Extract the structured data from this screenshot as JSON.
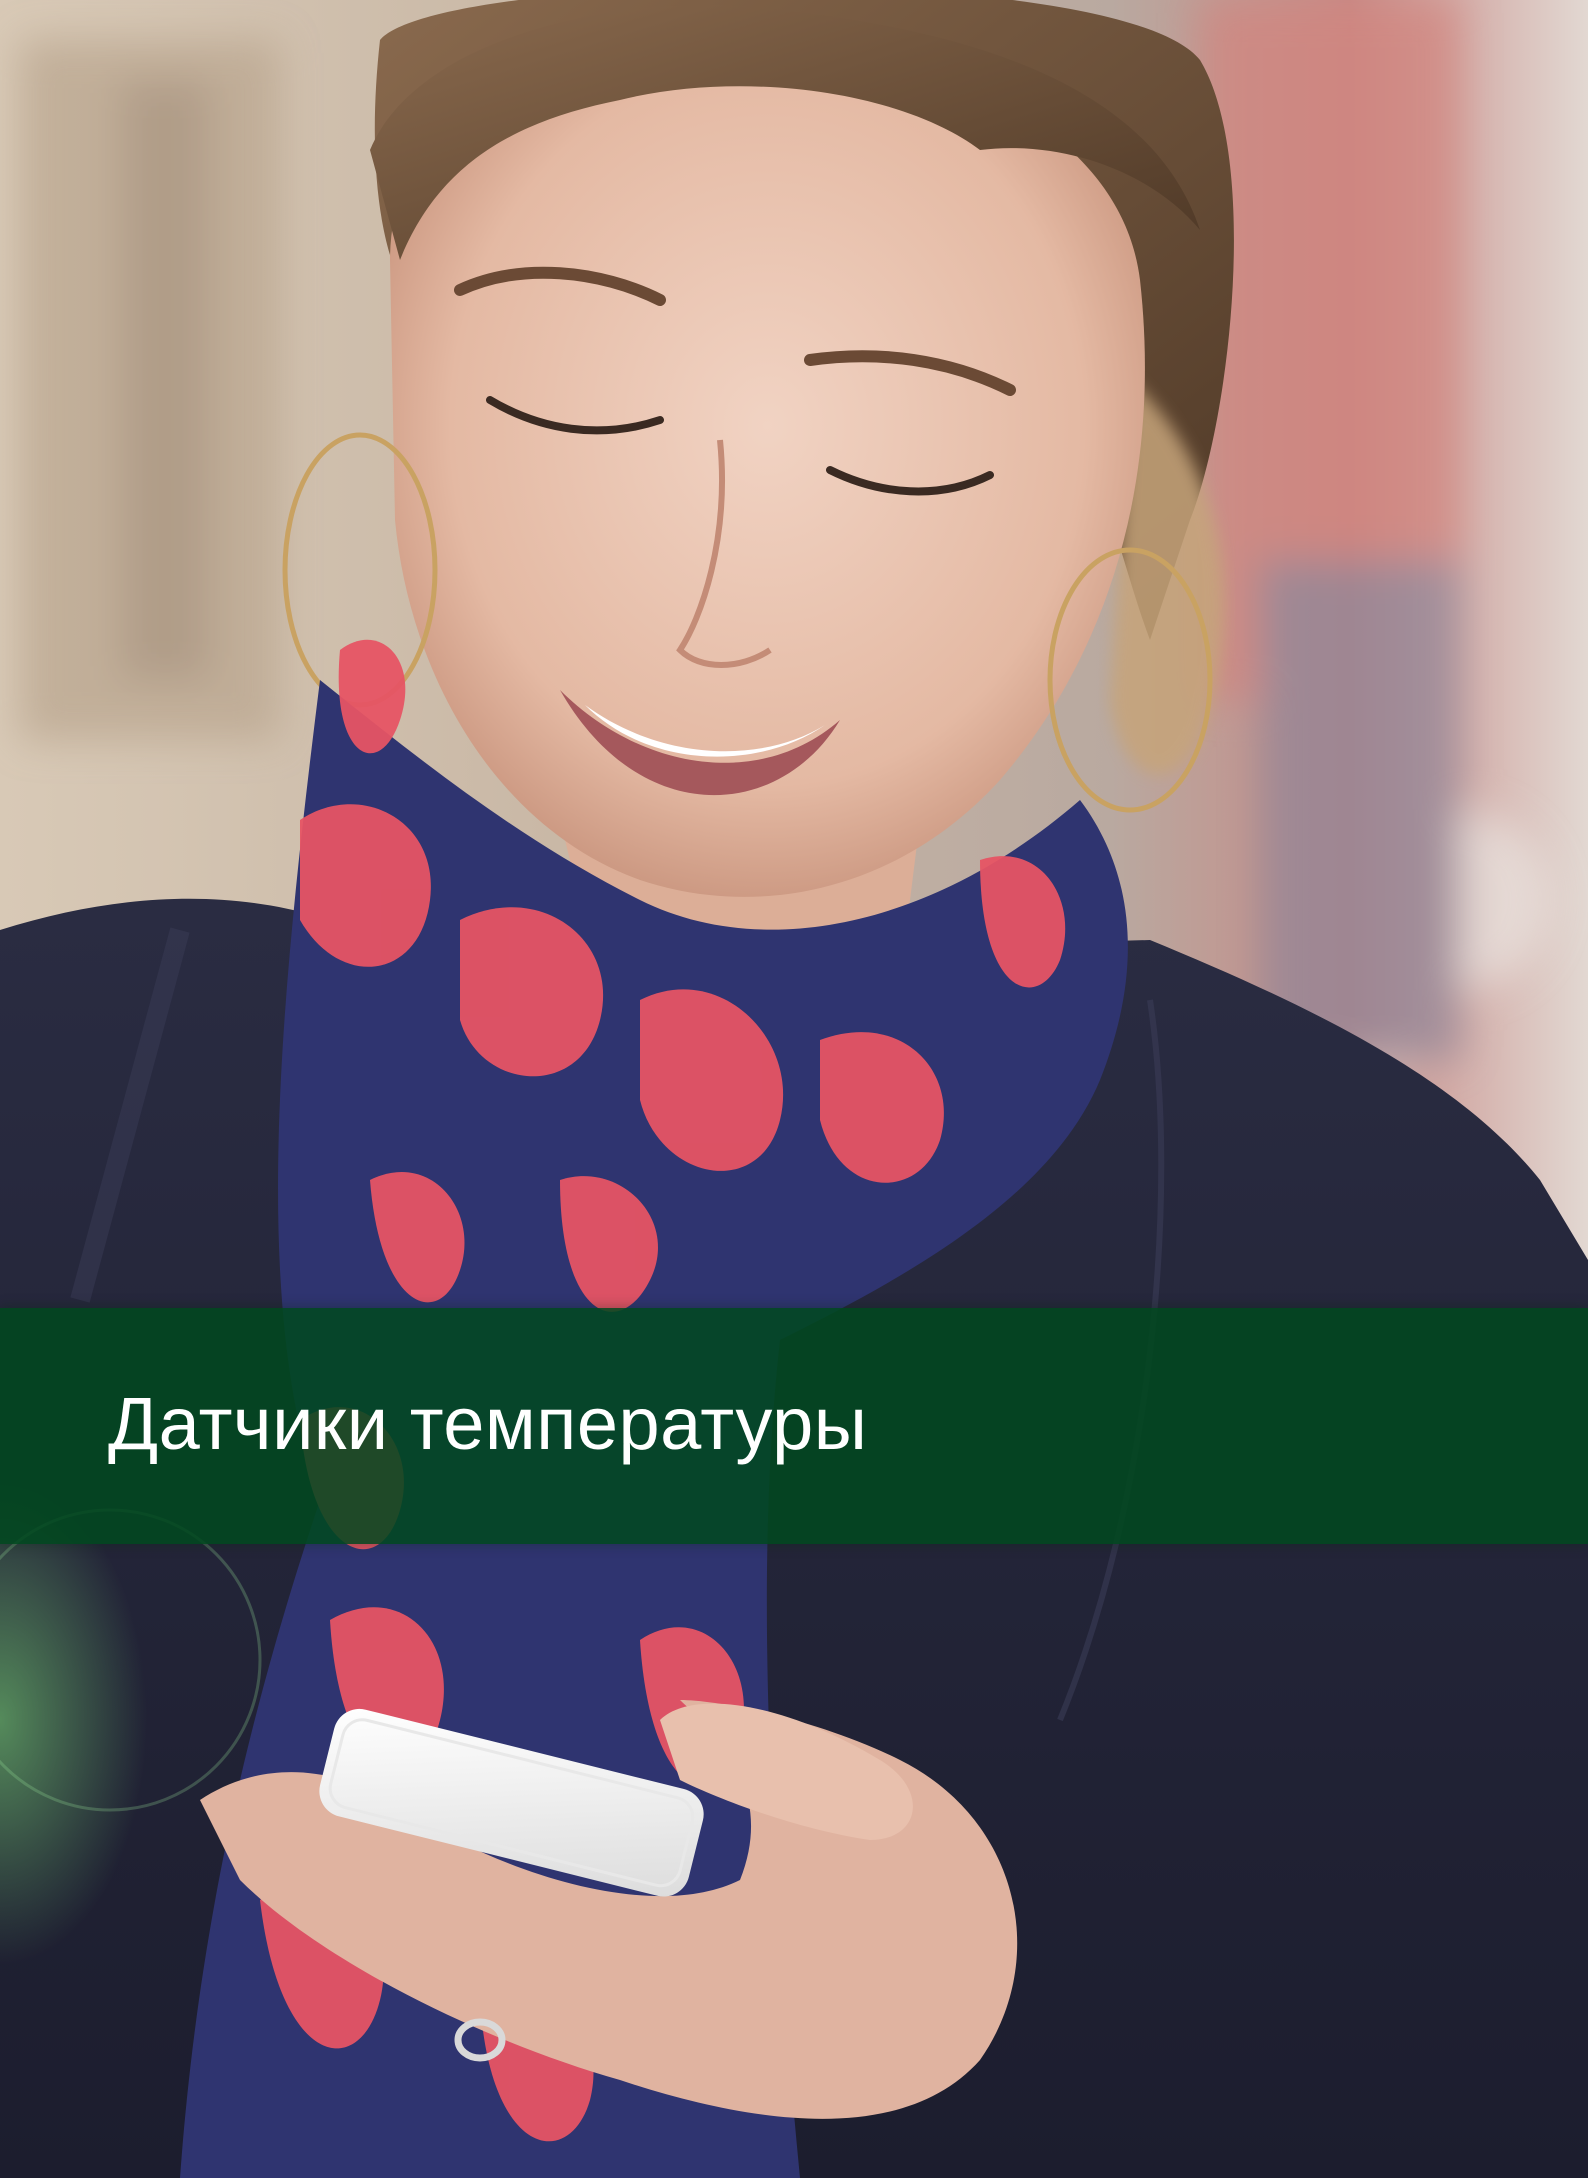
{
  "cover": {
    "photo": "woman-smiling-at-smartphone",
    "title": "Датчики температуры"
  },
  "colors": {
    "band": "#00481e",
    "title_text": "#ffffff"
  }
}
